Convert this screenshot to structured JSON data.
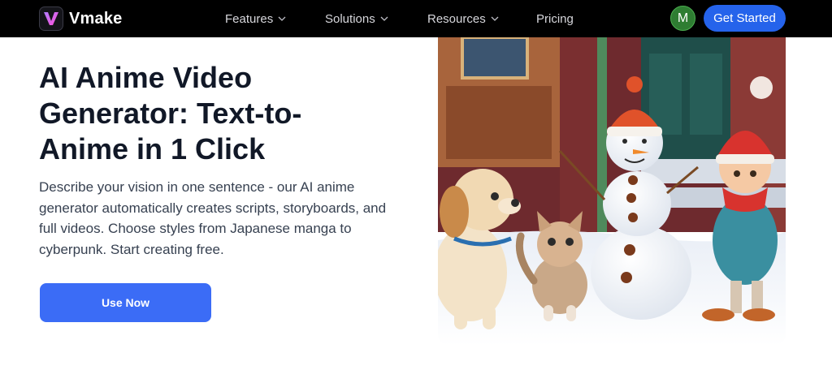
{
  "header": {
    "brand": "Vmake",
    "logo_letter": "V",
    "nav": [
      {
        "label": "Features",
        "icon": "chevron-down-icon"
      },
      {
        "label": "Solutions",
        "icon": "chevron-down-icon"
      },
      {
        "label": "Resources",
        "icon": "chevron-down-icon"
      },
      {
        "label": "Pricing"
      }
    ],
    "avatar_initial": "M",
    "cta_label": "Get Started"
  },
  "hero": {
    "title": "AI Anime Video Generator: Text-to-Anime in 1 Click",
    "description": "Describe your vision in one sentence - our AI anime generator automatically creates scripts, storyboards, and full videos. Choose styles from Japanese manga to cyberpunk. Start creating free.",
    "button_label": "Use Now",
    "image": "anime-winter-scene-illustration"
  },
  "colors": {
    "nav_background": "#000000",
    "accent": "#2563eb",
    "button": "#3b6cf6",
    "avatar": "#2e7d32"
  }
}
